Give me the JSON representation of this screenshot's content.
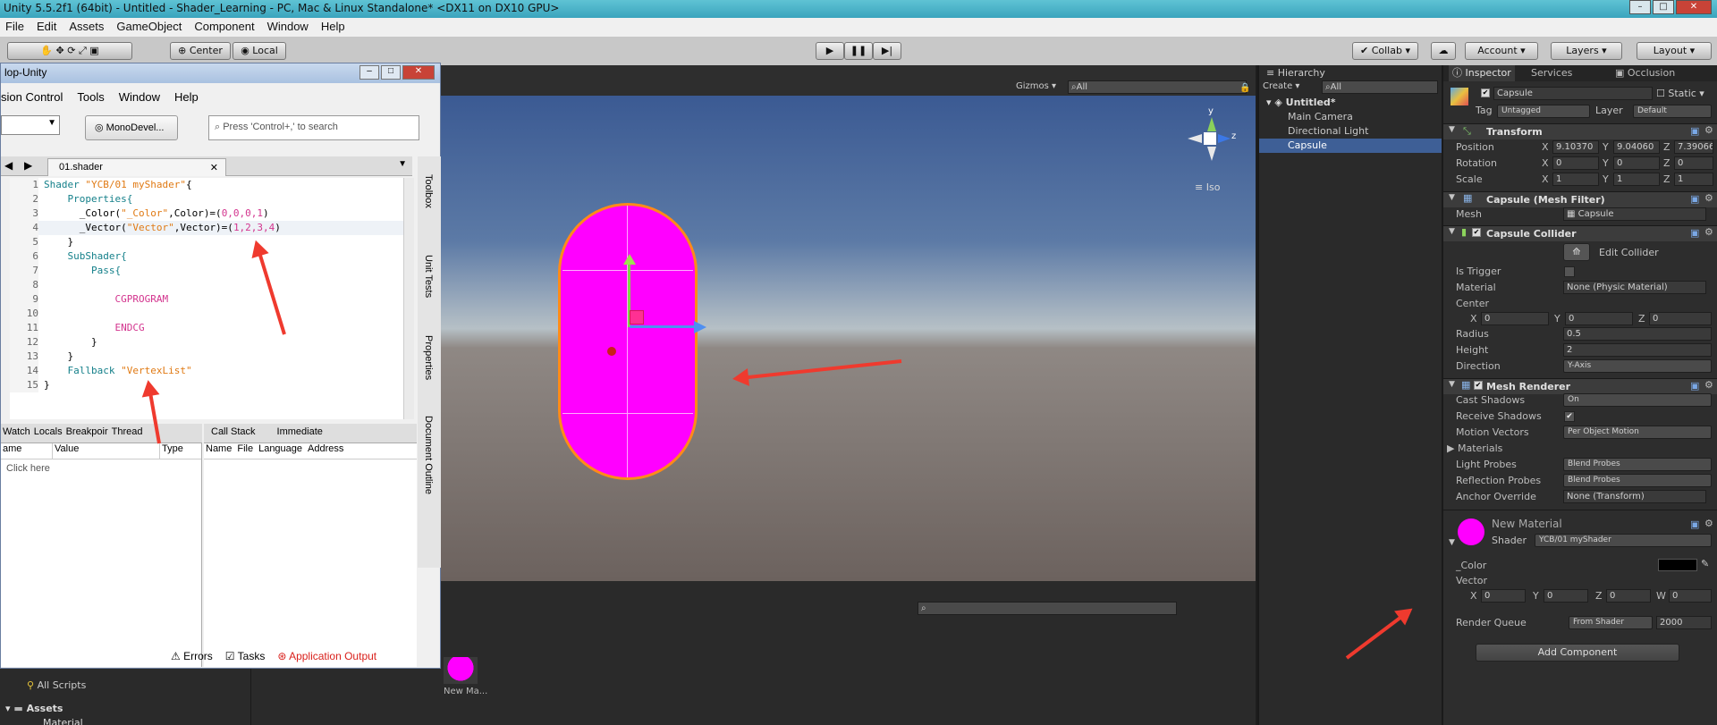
{
  "window": {
    "title": "Unity 5.5.2f1 (64bit) - Untitled - Shader_Learning - PC, Mac & Linux Standalone* <DX11 on DX10 GPU>"
  },
  "menu": [
    "File",
    "Edit",
    "Assets",
    "GameObject",
    "Component",
    "Window",
    "Help"
  ],
  "toolbar": {
    "center": "Center",
    "local": "Local",
    "collab": "Collab",
    "account": "Account",
    "layers": "Layers",
    "layout": "Layout"
  },
  "scene": {
    "gizmos": "Gizmos",
    "search_placeholder": "All",
    "iso": "Iso",
    "axis_y": "y",
    "axis_z": "z"
  },
  "codewin": {
    "title": "lop-Unity",
    "menu": [
      "sion Control",
      "Tools",
      "Window",
      "Help"
    ],
    "monodevelop_button": "MonoDevel...",
    "search_placeholder": "Press 'Control+,' to search",
    "file_tab": "01.shader",
    "side_tabs": [
      "Toolbox",
      "Unit Tests",
      "Properties",
      "Document Outline"
    ],
    "code_lines": [
      {
        "n": "1",
        "parts": [
          [
            "kw",
            "Shader "
          ],
          [
            "str",
            "\"YCB/01 myShader\""
          ],
          [
            "pl",
            "{"
          ]
        ]
      },
      {
        "n": "2",
        "parts": [
          [
            "kw",
            "    Properties{"
          ]
        ]
      },
      {
        "n": "3",
        "parts": [
          [
            "pl",
            "      _Color("
          ],
          [
            "str",
            "\"_Color\""
          ],
          [
            "pl",
            ",Color)=("
          ],
          [
            "num",
            "0,0,0,1"
          ],
          [
            "pl",
            ")"
          ]
        ]
      },
      {
        "n": "4",
        "parts": [
          [
            "pl",
            "      _Vector("
          ],
          [
            "str",
            "\"Vector\""
          ],
          [
            "pl",
            ",Vector)=("
          ],
          [
            "num",
            "1,2,3,4"
          ],
          [
            "pl",
            ")"
          ]
        ]
      },
      {
        "n": "5",
        "parts": [
          [
            "pl",
            "    }"
          ]
        ]
      },
      {
        "n": "6",
        "parts": [
          [
            "kw",
            "    SubShader{"
          ]
        ]
      },
      {
        "n": "7",
        "parts": [
          [
            "kw",
            "        Pass{"
          ]
        ]
      },
      {
        "n": "8",
        "parts": [
          [
            "pl",
            ""
          ]
        ]
      },
      {
        "n": "9",
        "parts": [
          [
            "num",
            "            CGPROGRAM"
          ]
        ]
      },
      {
        "n": "10",
        "parts": [
          [
            "pl",
            ""
          ]
        ]
      },
      {
        "n": "11",
        "parts": [
          [
            "num",
            "            ENDCG"
          ]
        ]
      },
      {
        "n": "12",
        "parts": [
          [
            "pl",
            "        }"
          ]
        ]
      },
      {
        "n": "13",
        "parts": [
          [
            "pl",
            "    }"
          ]
        ]
      },
      {
        "n": "14",
        "parts": [
          [
            "kw",
            "    Fallback "
          ],
          [
            "str",
            "\"VertexList\""
          ]
        ]
      },
      {
        "n": "15",
        "parts": [
          [
            "pl",
            "}"
          ]
        ]
      }
    ],
    "debug_tabs_left": [
      "Watch",
      "Locals",
      "Breakpoir",
      "Thread"
    ],
    "debug_tabs_right": [
      "Call Stack",
      "Immediate"
    ],
    "watch_columns": [
      "ame",
      "Value",
      "Type"
    ],
    "watch_row": "Click here",
    "callstack_columns": [
      "Name",
      "File",
      "Language",
      "Address"
    ],
    "status": [
      "Errors",
      "Tasks",
      "Application Output"
    ]
  },
  "project": {
    "all_scripts": "All Scripts",
    "assets": "Assets",
    "material": "Material",
    "asset_item": "New Ma..."
  },
  "hierarchy": {
    "tab": "Hierarchy",
    "create": "Create",
    "search_placeholder": "All",
    "scene": "Untitled*",
    "items": [
      "Main Camera",
      "Directional Light",
      "Capsule"
    ]
  },
  "inspector": {
    "tabs": [
      "Inspector",
      "Services",
      "Occlusion"
    ],
    "object_name": "Capsule",
    "static": "Static",
    "tag_label": "Tag",
    "tag": "Untagged",
    "layer_label": "Layer",
    "layer": "Default",
    "transform": {
      "title": "Transform",
      "rows": [
        {
          "label": "Position",
          "x": "9.10370",
          "y": "9.04060",
          "z": "7.39066"
        },
        {
          "label": "Rotation",
          "x": "0",
          "y": "0",
          "z": "0"
        },
        {
          "label": "Scale",
          "x": "1",
          "y": "1",
          "z": "1"
        }
      ]
    },
    "mesh_filter": {
      "title": "Capsule (Mesh Filter)",
      "mesh_label": "Mesh",
      "mesh": "Capsule"
    },
    "collider": {
      "title": "Capsule Collider",
      "edit": "Edit Collider",
      "is_trigger": "Is Trigger",
      "material_label": "Material",
      "material": "None (Physic Material)",
      "center_label": "Center",
      "cx": "0",
      "cy": "0",
      "cz": "0",
      "radius_label": "Radius",
      "radius": "0.5",
      "height_label": "Height",
      "height": "2",
      "direction_label": "Direction",
      "direction": "Y-Axis"
    },
    "renderer": {
      "title": "Mesh Renderer",
      "cast_shadows_label": "Cast Shadows",
      "cast_shadows": "On",
      "receive_shadows_label": "Receive Shadows",
      "motion_vectors_label": "Motion Vectors",
      "motion_vectors": "Per Object Motion",
      "materials_label": "Materials",
      "light_probes_label": "Light Probes",
      "light_probes": "Blend Probes",
      "reflection_probes_label": "Reflection Probes",
      "reflection_probes": "Blend Probes",
      "anchor_override_label": "Anchor Override",
      "anchor_override": "None (Transform)"
    },
    "material": {
      "name": "New Material",
      "shader_label": "Shader",
      "shader": "YCB/01 myShader",
      "color_label": "_Color",
      "vector_label": "Vector",
      "vx": "0",
      "vy": "0",
      "vz": "0",
      "vw": "0",
      "render_queue_label": "Render Queue",
      "render_queue_mode": "From Shader",
      "render_queue": "2000"
    },
    "add_component": "Add Component"
  },
  "colors": {
    "accent": "#ef3a2e",
    "capsule": "#ff00ff",
    "selection": "#3e5f96"
  }
}
